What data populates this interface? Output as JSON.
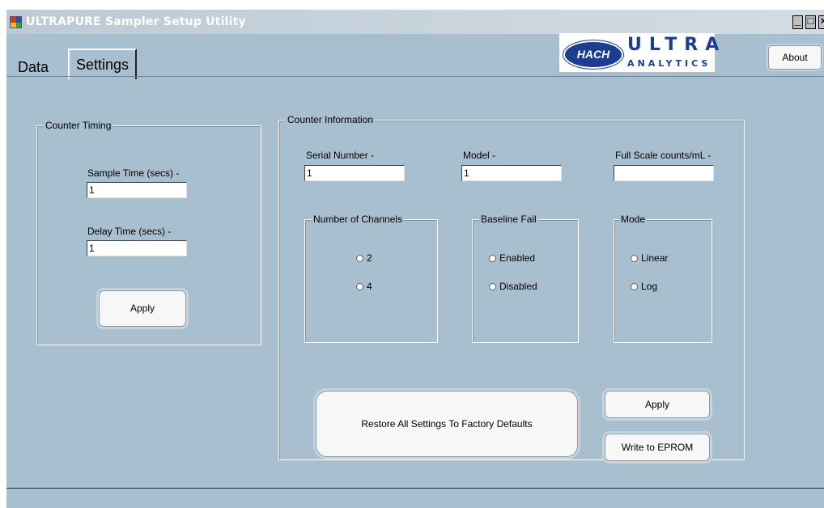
{
  "window": {
    "title": "ULTRAPURE Sampler Setup Utility",
    "min_label": "_",
    "max_label": "□",
    "close_label": "×"
  },
  "tabs": [
    {
      "label": "Data"
    },
    {
      "label": "Settings"
    }
  ],
  "logo": {
    "hach": "HACH",
    "ultra": "ULTRA",
    "analytics": "ANALYTICS"
  },
  "about_label": "About",
  "counter_timing": {
    "title": "Counter Timing",
    "sample_label": "Sample Time (secs) -",
    "sample_value": "1",
    "delay_label": "Delay Time (secs) -",
    "delay_value": "1",
    "apply_label": "Apply"
  },
  "counter_info": {
    "title": "Counter Information",
    "serial_label": "Serial Number -",
    "serial_value": "1",
    "model_label": "Model -",
    "model_value": "1",
    "fullscale_label": "Full Scale counts/mL -",
    "fullscale_value": "",
    "channels": {
      "title": "Number of Channels",
      "options": [
        "2",
        "4"
      ]
    },
    "baseline": {
      "title": "Baseline Fail",
      "options": [
        "Enabled",
        "Disabled"
      ]
    },
    "mode": {
      "title": "Mode",
      "options": [
        "Linear",
        "Log"
      ]
    },
    "restore_label": "Restore All Settings To Factory Defaults",
    "apply_label": "Apply",
    "eprom_label": "Write to EPROM"
  }
}
